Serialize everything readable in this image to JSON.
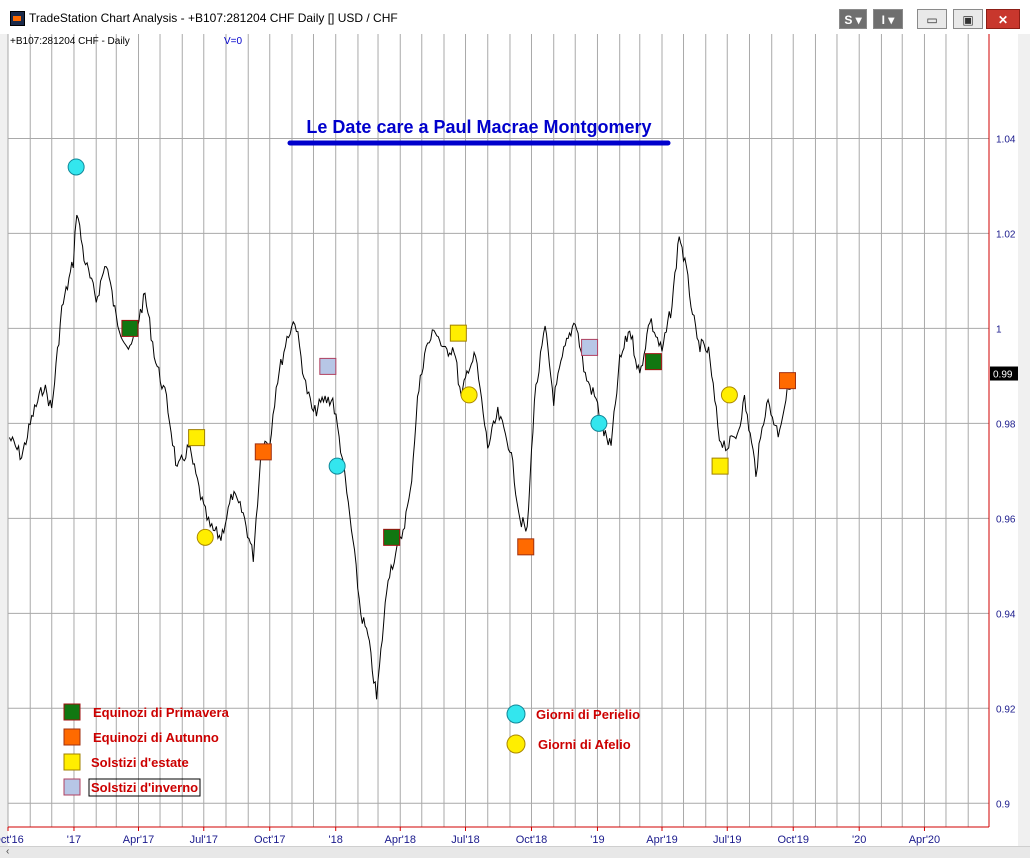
{
  "window": {
    "title": "TradeStation Chart Analysis - +B107:281204 CHF Daily [] USD / CHF",
    "buttons": {
      "s_label": "S ▾",
      "i_label": "I ▾",
      "min_label": "▭",
      "max_label": "▣",
      "close_label": "✕"
    }
  },
  "chart_header": {
    "symbol": "+B107:281204 CHF - Daily",
    "volume": "V=0"
  },
  "colors": {
    "price": "#000000",
    "grid": "#a9a9a9",
    "axis_text": "#1a1a8c",
    "title": "#0000cc",
    "red_line": "#d00000",
    "green": "#117711",
    "orange": "#ff6a00",
    "yellow": "#ffee00",
    "cyan": "#33e6ee",
    "winter": "#b7c6e6",
    "legend_text": "#cc0000"
  },
  "chart_data": {
    "type": "line",
    "title": "Le Date care a Paul Macrae Montgomery",
    "xlabel": "",
    "ylabel": "",
    "ylim": [
      0.895,
      1.062
    ],
    "yticks": [
      "1.04",
      "1.02",
      "1",
      "0.98",
      "0.96",
      "0.94",
      "0.92",
      "0.9"
    ],
    "yticks_values": [
      1.04,
      1.02,
      1.0,
      0.98,
      0.96,
      0.94,
      0.92,
      0.9
    ],
    "xlim": [
      "2016-10-01",
      "2020-06-30"
    ],
    "xticks": [
      "Oct'16",
      "'17",
      "Apr'17",
      "Jul'17",
      "Oct'17",
      "'18",
      "Apr'18",
      "Jul'18",
      "Oct'18",
      "'19",
      "Apr'19",
      "Jul'19",
      "Oct'19",
      "'20",
      "Apr'20"
    ],
    "xticks_dates": [
      "2016-10-01",
      "2017-01-01",
      "2017-04-01",
      "2017-07-01",
      "2017-10-01",
      "2018-01-01",
      "2018-04-01",
      "2018-07-01",
      "2018-10-01",
      "2019-01-01",
      "2019-04-01",
      "2019-07-01",
      "2019-10-01",
      "2020-01-01",
      "2020-04-01"
    ],
    "last_value_label": "0.99",
    "last_value": 0.9905,
    "series": [
      {
        "x": [
          "2016-10-03",
          "2016-10-20",
          "2016-11-05",
          "2016-11-20",
          "2016-12-01",
          "2016-12-15",
          "2016-12-31",
          "2017-01-05",
          "2017-01-15",
          "2017-02-01",
          "2017-02-15",
          "2017-03-01",
          "2017-03-20",
          "2017-04-10",
          "2017-04-25",
          "2017-05-10",
          "2017-05-25",
          "2017-06-10",
          "2017-06-20",
          "2017-07-01",
          "2017-07-10",
          "2017-07-25",
          "2017-08-10",
          "2017-08-25",
          "2017-09-08",
          "2017-09-20",
          "2017-10-01",
          "2017-10-10",
          "2017-10-25",
          "2017-11-05",
          "2017-11-20",
          "2017-12-01",
          "2017-12-15",
          "2017-12-28",
          "2018-01-10",
          "2018-01-25",
          "2018-02-05",
          "2018-02-15",
          "2018-02-27",
          "2018-03-15",
          "2018-04-01",
          "2018-04-15",
          "2018-04-25",
          "2018-05-05",
          "2018-05-20",
          "2018-06-01",
          "2018-06-15",
          "2018-06-25",
          "2018-07-05",
          "2018-07-15",
          "2018-08-01",
          "2018-08-15",
          "2018-09-01",
          "2018-09-15",
          "2018-09-25",
          "2018-10-05",
          "2018-10-20",
          "2018-11-01",
          "2018-11-15",
          "2018-12-01",
          "2018-12-15",
          "2018-12-30",
          "2019-01-10",
          "2019-01-20",
          "2019-02-01",
          "2019-02-15",
          "2019-03-01",
          "2019-03-15",
          "2019-04-01",
          "2019-04-15",
          "2019-04-25",
          "2019-05-05",
          "2019-05-20",
          "2019-06-05",
          "2019-06-20",
          "2019-07-01",
          "2019-07-15",
          "2019-07-25",
          "2019-08-10",
          "2019-08-25",
          "2019-09-10",
          "2019-09-25",
          "2019-10-01"
        ],
        "values": [
          0.977,
          0.973,
          0.982,
          0.988,
          0.983,
          1.004,
          1.014,
          1.025,
          1.015,
          1.006,
          1.014,
          1.002,
          0.995,
          1.007,
          0.993,
          0.985,
          0.97,
          0.975,
          0.969,
          0.962,
          0.958,
          0.956,
          0.965,
          0.961,
          0.952,
          0.976,
          0.976,
          0.988,
          0.998,
          1.002,
          0.988,
          0.982,
          0.985,
          0.985,
          0.973,
          0.955,
          0.94,
          0.935,
          0.922,
          0.948,
          0.955,
          0.965,
          0.985,
          0.995,
          1.0,
          0.995,
          0.996,
          0.985,
          0.992,
          0.994,
          0.975,
          0.982,
          0.975,
          0.96,
          0.957,
          0.985,
          1.0,
          0.985,
          0.995,
          1.002,
          0.99,
          0.985,
          0.978,
          0.975,
          0.993,
          1.0,
          0.99,
          1.002,
          0.995,
          1.005,
          1.02,
          1.012,
          0.997,
          0.995,
          0.977,
          0.975,
          0.978,
          0.985,
          0.97,
          0.985,
          0.978,
          0.988,
          0.99
        ]
      }
    ],
    "markers": [
      {
        "type": "equinox_spring",
        "x": "2017-03-20",
        "y": 1.0
      },
      {
        "type": "equinox_spring",
        "x": "2018-03-20",
        "y": 0.956
      },
      {
        "type": "equinox_spring",
        "x": "2019-03-20",
        "y": 0.993
      },
      {
        "type": "equinox_autumn",
        "x": "2017-09-22",
        "y": 0.974
      },
      {
        "type": "equinox_autumn",
        "x": "2018-09-23",
        "y": 0.954
      },
      {
        "type": "equinox_autumn",
        "x": "2019-09-23",
        "y": 0.989
      },
      {
        "type": "solstice_summer",
        "x": "2017-06-21",
        "y": 0.977
      },
      {
        "type": "solstice_summer",
        "x": "2018-06-21",
        "y": 0.999
      },
      {
        "type": "solstice_summer",
        "x": "2019-06-21",
        "y": 0.971
      },
      {
        "type": "solstice_winter",
        "x": "2017-12-21",
        "y": 0.992
      },
      {
        "type": "solstice_winter",
        "x": "2018-12-21",
        "y": 0.996
      },
      {
        "type": "perihelion",
        "x": "2017-01-04",
        "y": 1.034
      },
      {
        "type": "perihelion",
        "x": "2018-01-03",
        "y": 0.971
      },
      {
        "type": "perihelion",
        "x": "2019-01-03",
        "y": 0.98
      },
      {
        "type": "aphelion",
        "x": "2017-07-03",
        "y": 0.956
      },
      {
        "type": "aphelion",
        "x": "2018-07-06",
        "y": 0.986
      },
      {
        "type": "aphelion",
        "x": "2019-07-04",
        "y": 0.986
      }
    ],
    "legend": {
      "left": [
        {
          "type": "equinox_spring",
          "label": "Equinozi di Primavera"
        },
        {
          "type": "equinox_autumn",
          "label": "Equinozi di Autunno"
        },
        {
          "type": "solstice_summer",
          "label": "Solstizi d'estate"
        },
        {
          "type": "solstice_winter",
          "label": "Solstizi d'inverno"
        }
      ],
      "right": [
        {
          "type": "perihelion",
          "label": "Giorni di Perielio"
        },
        {
          "type": "aphelion",
          "label": "Giorni di Afelio"
        }
      ]
    }
  }
}
